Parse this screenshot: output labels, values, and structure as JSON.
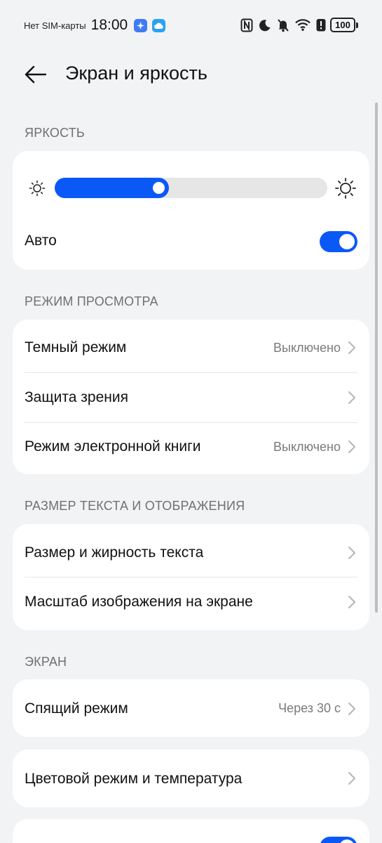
{
  "status_bar": {
    "carrier": "Нет SIM-карты",
    "time": "18:00",
    "battery": "100",
    "icons": [
      "app-badge-icon",
      "cloud-icon",
      "nfc-icon",
      "moon-icon",
      "bell-off-icon",
      "wifi-icon",
      "battery-saver-icon",
      "battery-icon"
    ]
  },
  "header": {
    "title": "Экран и яркость",
    "back_icon": "arrow-left-icon"
  },
  "brightness": {
    "section": "ЯРКОСТЬ",
    "level": 0.42,
    "auto_label": "Авто",
    "auto_on": true
  },
  "view_mode": {
    "section": "РЕЖИМ ПРОСМОТРА",
    "items": [
      {
        "label": "Темный режим",
        "value": "Выключено"
      },
      {
        "label": "Защита зрения",
        "value": ""
      },
      {
        "label": "Режим электронной книги",
        "value": "Выключено"
      }
    ]
  },
  "text_size": {
    "section": "РАЗМЕР ТЕКСТА И ОТОБРАЖЕНИЯ",
    "items": [
      {
        "label": "Размер и жирность текста"
      },
      {
        "label": "Масштаб изображения на экране"
      }
    ]
  },
  "screen": {
    "section": "ЭКРАН",
    "sleep_label": "Спящий режим",
    "sleep_value": "Через 30 с",
    "color_label": "Цветовой режим и температура",
    "partial_toggle_on": true
  },
  "colors": {
    "accent": "#0a59f7",
    "background": "#f1f3f5",
    "card": "#ffffff"
  }
}
